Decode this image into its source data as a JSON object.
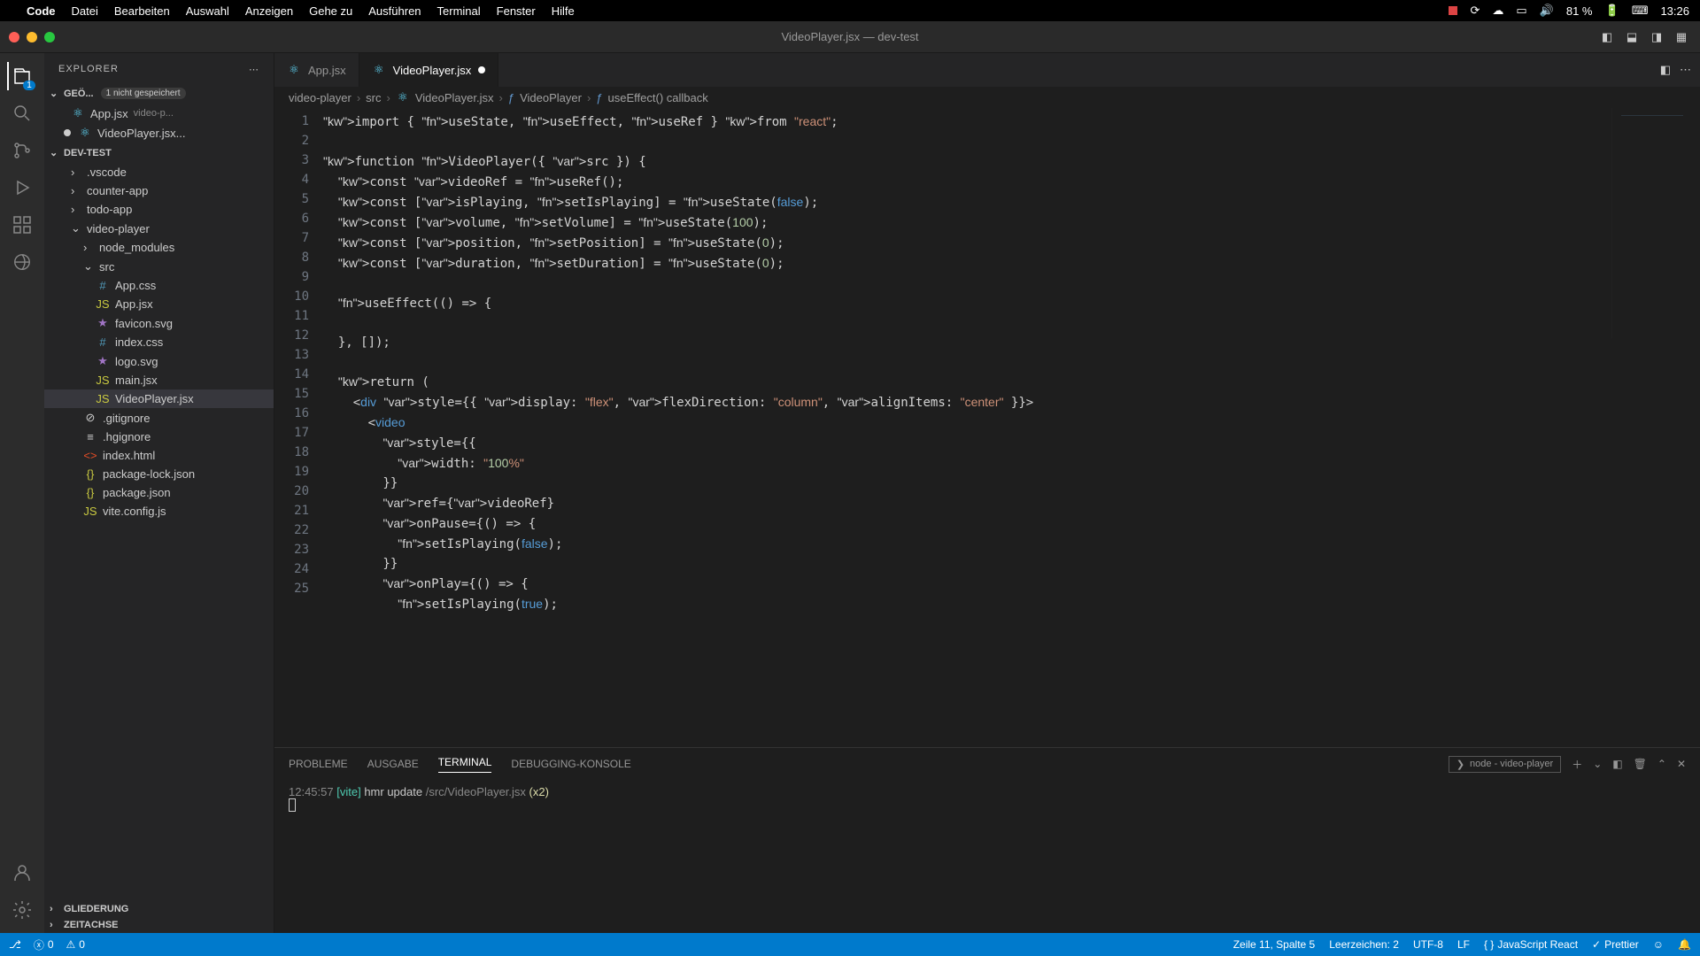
{
  "menubar": {
    "app": "Code",
    "items": [
      "Datei",
      "Bearbeiten",
      "Auswahl",
      "Anzeigen",
      "Gehe zu",
      "Ausführen",
      "Terminal",
      "Fenster",
      "Hilfe"
    ],
    "battery": "81 %",
    "time": "13:26"
  },
  "titlebar": {
    "title": "VideoPlayer.jsx — dev-test"
  },
  "activitybar": {
    "explorer_badge": "1"
  },
  "sidebar": {
    "title": "EXPLORER",
    "open_editors_label": "GEÖ...",
    "unsaved_label": "1 nicht gespeichert",
    "open_editors": [
      {
        "name": "App.jsx",
        "hint": "video-p...",
        "modified": false
      },
      {
        "name": "VideoPlayer.jsx...",
        "hint": "",
        "modified": true
      }
    ],
    "project": "DEV-TEST",
    "tree": [
      {
        "depth": 1,
        "type": "folder",
        "open": false,
        "name": ".vscode"
      },
      {
        "depth": 1,
        "type": "folder",
        "open": false,
        "name": "counter-app"
      },
      {
        "depth": 1,
        "type": "folder",
        "open": false,
        "name": "todo-app"
      },
      {
        "depth": 1,
        "type": "folder",
        "open": true,
        "name": "video-player"
      },
      {
        "depth": 2,
        "type": "folder",
        "open": false,
        "name": "node_modules"
      },
      {
        "depth": 2,
        "type": "folder",
        "open": true,
        "name": "src"
      },
      {
        "depth": 3,
        "type": "file",
        "icon": "#",
        "name": "App.css"
      },
      {
        "depth": 3,
        "type": "file",
        "icon": "JS",
        "name": "App.jsx"
      },
      {
        "depth": 3,
        "type": "file",
        "icon": "★",
        "name": "favicon.svg"
      },
      {
        "depth": 3,
        "type": "file",
        "icon": "#",
        "name": "index.css"
      },
      {
        "depth": 3,
        "type": "file",
        "icon": "★",
        "name": "logo.svg"
      },
      {
        "depth": 3,
        "type": "file",
        "icon": "JS",
        "name": "main.jsx"
      },
      {
        "depth": 3,
        "type": "file",
        "icon": "JS",
        "name": "VideoPlayer.jsx",
        "selected": true
      },
      {
        "depth": 2,
        "type": "file",
        "icon": "⊘",
        "name": ".gitignore"
      },
      {
        "depth": 2,
        "type": "file",
        "icon": "≡",
        "name": ".hgignore"
      },
      {
        "depth": 2,
        "type": "file",
        "icon": "<>",
        "name": "index.html"
      },
      {
        "depth": 2,
        "type": "file",
        "icon": "{}",
        "name": "package-lock.json"
      },
      {
        "depth": 2,
        "type": "file",
        "icon": "{}",
        "name": "package.json"
      },
      {
        "depth": 2,
        "type": "file",
        "icon": "JS",
        "name": "vite.config.js"
      }
    ],
    "outline": "GLIEDERUNG",
    "timeline": "ZEITACHSE"
  },
  "tabs": [
    {
      "label": "App.jsx",
      "active": false,
      "dirty": false
    },
    {
      "label": "VideoPlayer.jsx",
      "active": true,
      "dirty": true
    }
  ],
  "breadcrumb": [
    "video-player",
    "src",
    "VideoPlayer.jsx",
    "VideoPlayer",
    "useEffect() callback"
  ],
  "code_lines": [
    "import { useState, useEffect, useRef } from \"react\";",
    "",
    "function VideoPlayer({ src }) {",
    "  const videoRef = useRef();",
    "  const [isPlaying, setIsPlaying] = useState(false);",
    "  const [volume, setVolume] = useState(100);",
    "  const [position, setPosition] = useState(0);",
    "  const [duration, setDuration] = useState(0);",
    "",
    "  useEffect(() => {",
    "    ",
    "  }, []);",
    "",
    "  return (",
    "    <div style={{ display: \"flex\", flexDirection: \"column\", alignItems: \"center\" }}>",
    "      <video",
    "        style={{",
    "          width: \"100%\"",
    "        }}",
    "        ref={videoRef}",
    "        onPause={() => {",
    "          setIsPlaying(false);",
    "        }}",
    "        onPlay={() => {",
    "          setIsPlaying(true);"
  ],
  "panel": {
    "tabs": [
      "PROBLEME",
      "AUSGABE",
      "TERMINAL",
      "DEBUGGING-KONSOLE"
    ],
    "active_tab": "TERMINAL",
    "terminal_name": "node - video-player",
    "output": {
      "time": "12:45:57",
      "tag": "[vite]",
      "msg": "hmr update",
      "path": "/src/VideoPlayer.jsx",
      "count": "(x2)"
    }
  },
  "statusbar": {
    "errors": "0",
    "warnings": "0",
    "cursor": "Zeile 11, Spalte 5",
    "spaces": "Leerzeichen: 2",
    "encoding": "UTF-8",
    "eol": "LF",
    "language": "JavaScript React",
    "prettier": "Prettier"
  }
}
